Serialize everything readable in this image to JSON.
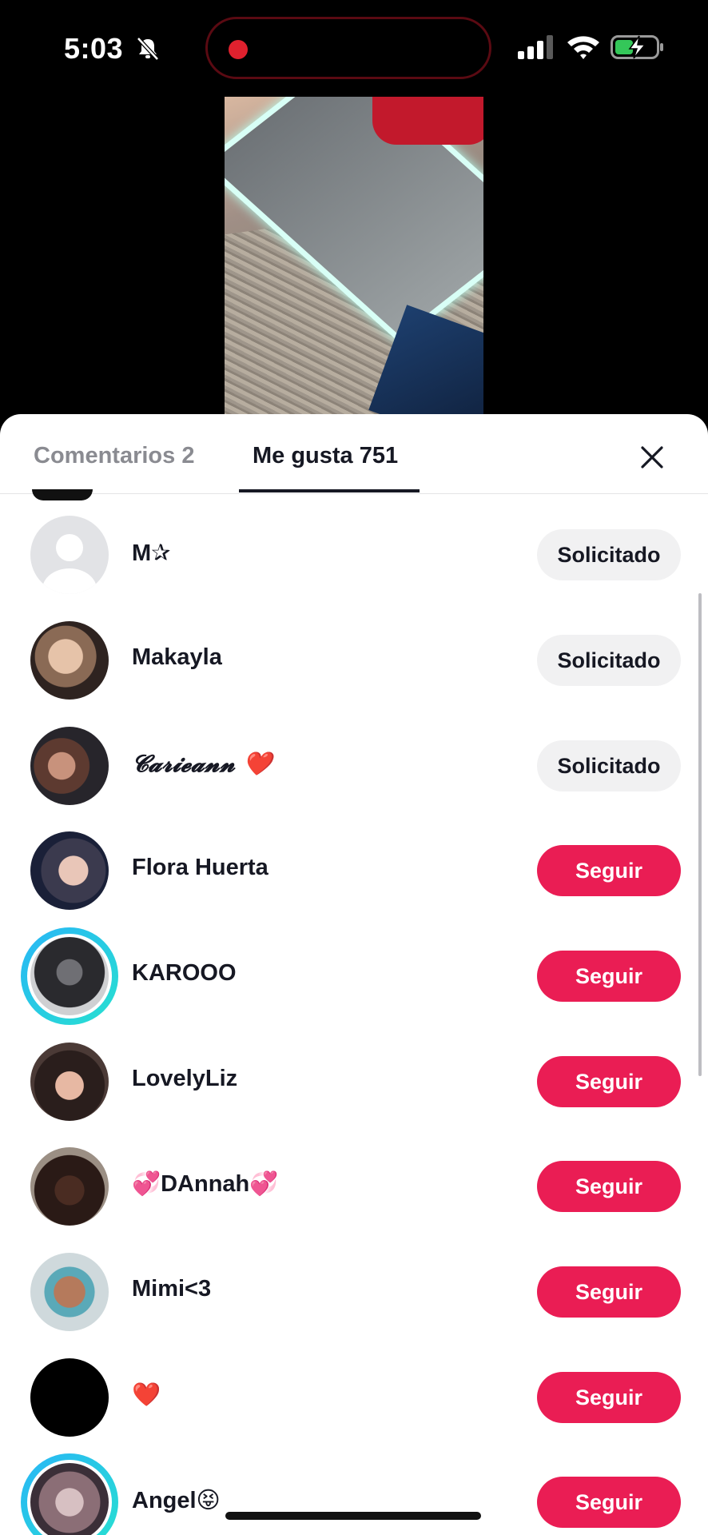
{
  "status_bar": {
    "time": "5:03",
    "icons": [
      "bell-slash-icon",
      "recording-dot-icon",
      "cellular-signal-icon",
      "wifi-icon",
      "battery-charging-icon"
    ]
  },
  "video": {
    "description_icon": "video-thumbnail"
  },
  "tabs": [
    {
      "label": "Comentarios 2",
      "active": false
    },
    {
      "label": "Me gusta 751",
      "active": true
    }
  ],
  "close_icon": "close-icon",
  "colors": {
    "accent": "#ea1d54",
    "requested_bg": "#f1f1f2",
    "ring": "#29b6f6"
  },
  "likes": [
    {
      "name": "M✰",
      "button": "Solicitado",
      "state": "requested",
      "avatar": "default-avatar"
    },
    {
      "name": "Makayla",
      "button": "Solicitado",
      "state": "requested",
      "avatar": "photo"
    },
    {
      "name": "𝓒𝓪𝓻𝓲𝓮𝓪𝓷𝓷 ❤️",
      "button": "Solicitado",
      "state": "requested",
      "avatar": "photo"
    },
    {
      "name": "Flora Huerta",
      "button": "Seguir",
      "state": "follow",
      "avatar": "photo"
    },
    {
      "name": "KAROOO",
      "button": "Seguir",
      "state": "follow",
      "avatar": "photo-story-ring"
    },
    {
      "name": "LovelyLiz",
      "button": "Seguir",
      "state": "follow",
      "avatar": "photo"
    },
    {
      "name": "💞DAnnah💞",
      "button": "Seguir",
      "state": "follow",
      "avatar": "photo"
    },
    {
      "name": "Mimi<3",
      "button": "Seguir",
      "state": "follow",
      "avatar": "photo"
    },
    {
      "name": "❤️",
      "button": "Seguir",
      "state": "follow",
      "avatar": "black"
    },
    {
      "name": "Angel😝",
      "button": "Seguir",
      "state": "follow",
      "avatar": "photo-story-ring"
    }
  ]
}
